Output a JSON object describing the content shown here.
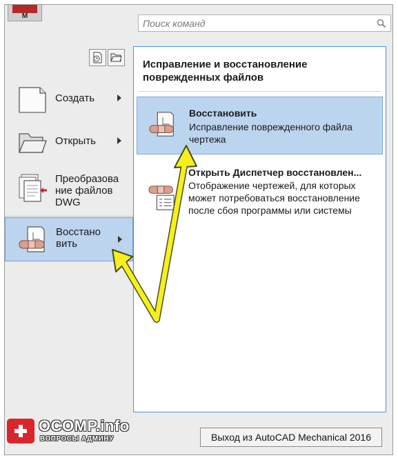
{
  "app_button": {
    "letter": "M"
  },
  "search": {
    "placeholder": "Поиск команд"
  },
  "toolbar": [
    {
      "name": "recent-documents",
      "icon": "clock-document-icon"
    },
    {
      "name": "open-documents",
      "icon": "folder-icon"
    }
  ],
  "left_menu": [
    {
      "label": "Создать",
      "icon": "new-document-icon",
      "has_submenu": true,
      "selected": false
    },
    {
      "label": "Открыть",
      "icon": "open-folder-icon",
      "has_submenu": true,
      "selected": false
    },
    {
      "label": "Преобразова ние файлов DWG",
      "icon": "convert-dwg-icon",
      "has_submenu": false,
      "selected": false
    },
    {
      "label": "Восстано вить",
      "icon": "recover-icon",
      "has_submenu": true,
      "selected": true
    }
  ],
  "submenu": {
    "header": "Исправление и восстановление поврежденных файлов",
    "items": [
      {
        "title": "Восстановить",
        "description": "Исправление поврежденного файла чертежа",
        "icon": "recover-file-icon",
        "active": true
      },
      {
        "title": "Открыть Диспетчер восстановлен...",
        "description": "Отображение чертежей, для которых может потребоваться восстановление после сбоя программы или системы",
        "icon": "recovery-manager-icon",
        "active": false
      }
    ]
  },
  "exit_button": {
    "label": "Выход из AutoCAD Mechanical 2016"
  },
  "watermark": {
    "title": "OCOMP.info",
    "subtitle": "ВОПРОСЫ АДМИНУ"
  },
  "annotation": {
    "color": "#f5ef1e",
    "outline": "#4a4a1a"
  },
  "colors": {
    "selection": "#bcd4ee",
    "selection_border": "#6f9fd8",
    "submenu_border": "#4a90d9",
    "app_accent": "#b42828"
  }
}
